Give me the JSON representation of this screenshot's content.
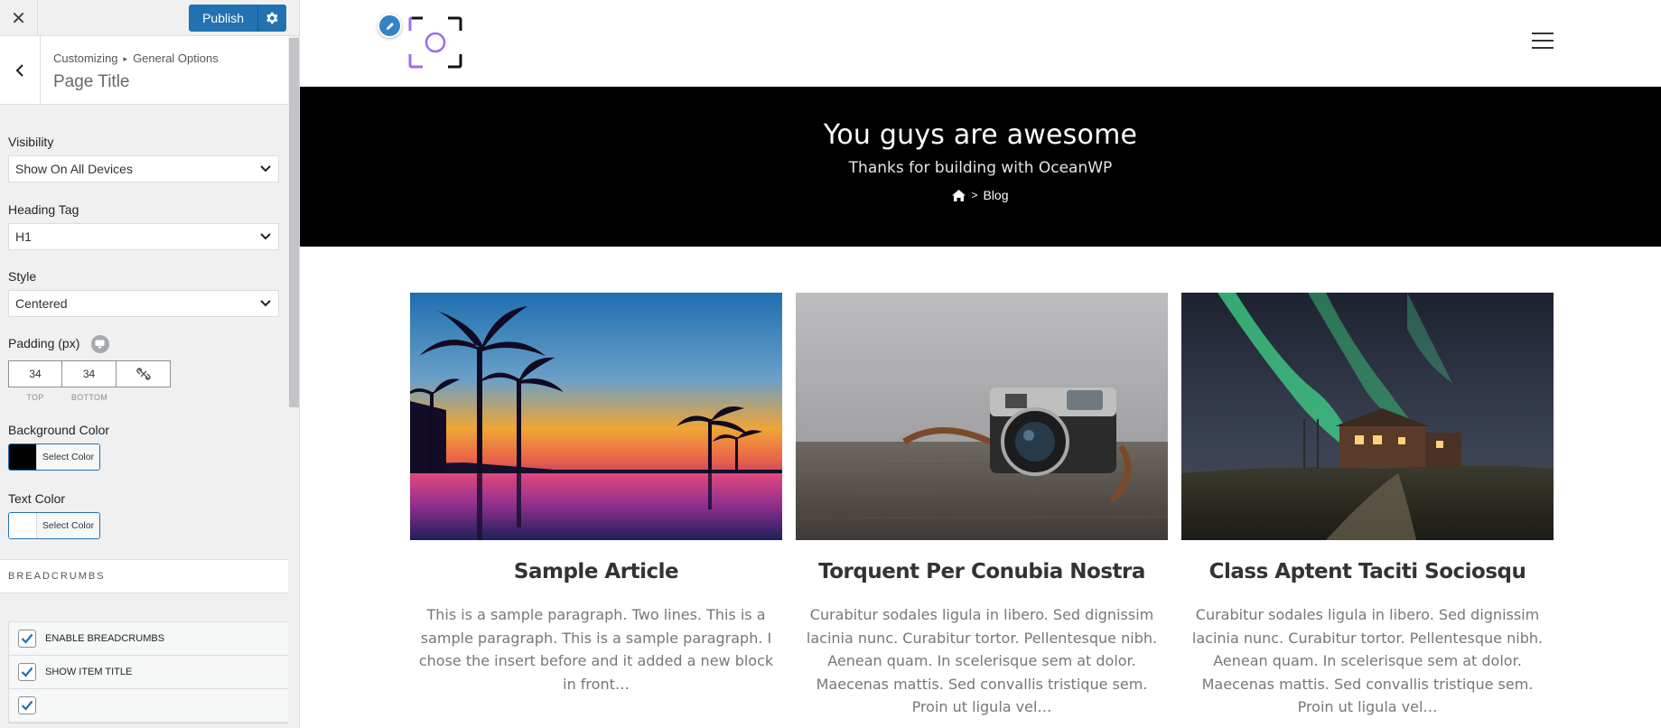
{
  "topbar": {
    "close_glyph": "✕",
    "publish_label": "Publish",
    "gear_icon": "gear-icon"
  },
  "section": {
    "breadcrumb_root": "Customizing",
    "breadcrumb_sep": "▸",
    "breadcrumb_parent": "General Options",
    "title": "Page Title"
  },
  "controls": {
    "visibility": {
      "label": "Visibility",
      "value": "Show On All Devices"
    },
    "heading_tag": {
      "label": "Heading Tag",
      "value": "H1"
    },
    "style": {
      "label": "Style",
      "value": "Centered"
    },
    "padding": {
      "label": "Padding (px)",
      "top": "34",
      "bottom": "34",
      "top_caption": "TOP",
      "bottom_caption": "BOTTOM"
    },
    "background_color": {
      "label": "Background Color",
      "button": "Select Color",
      "swatch": "#000000"
    },
    "text_color": {
      "label": "Text Color",
      "button": "Select Color",
      "swatch": "#ffffff"
    }
  },
  "breadcrumbs_section": {
    "heading": "BREADCRUMBS",
    "items": [
      {
        "label": "ENABLE BREADCRUMBS",
        "checked": true
      },
      {
        "label": "SHOW ITEM TITLE",
        "checked": true
      }
    ]
  },
  "preview": {
    "hero_title": "You guys are awesome",
    "hero_subtitle": "Thanks for building with OceanWP",
    "breadcrumb_sep": ">",
    "breadcrumb_current": "Blog",
    "accent_color": "#9d6cf0",
    "posts": [
      {
        "title": "Sample Article",
        "excerpt": "This is a sample paragraph. Two lines. This is a sample paragraph. This is a sample paragraph. I chose the insert before and it added a new block in front…",
        "image": "palm-sunset"
      },
      {
        "title": "Torquent Per Conubia Nostra",
        "excerpt": "Curabitur sodales ligula in libero. Sed dignissim lacinia nunc. Curabitur tortor. Pellentesque nibh. Aenean quam. In scelerisque sem at dolor. Maecenas mattis. Sed convallis tristique sem. Proin ut ligula vel…",
        "image": "vintage-camera"
      },
      {
        "title": "Class Aptent Taciti Sociosqu",
        "excerpt": "Curabitur sodales ligula in libero. Sed dignissim lacinia nunc. Curabitur tortor. Pellentesque nibh. Aenean quam. In scelerisque sem at dolor. Maecenas mattis. Sed convallis tristique sem. Proin ut ligula vel…",
        "image": "northern-lights"
      }
    ]
  }
}
